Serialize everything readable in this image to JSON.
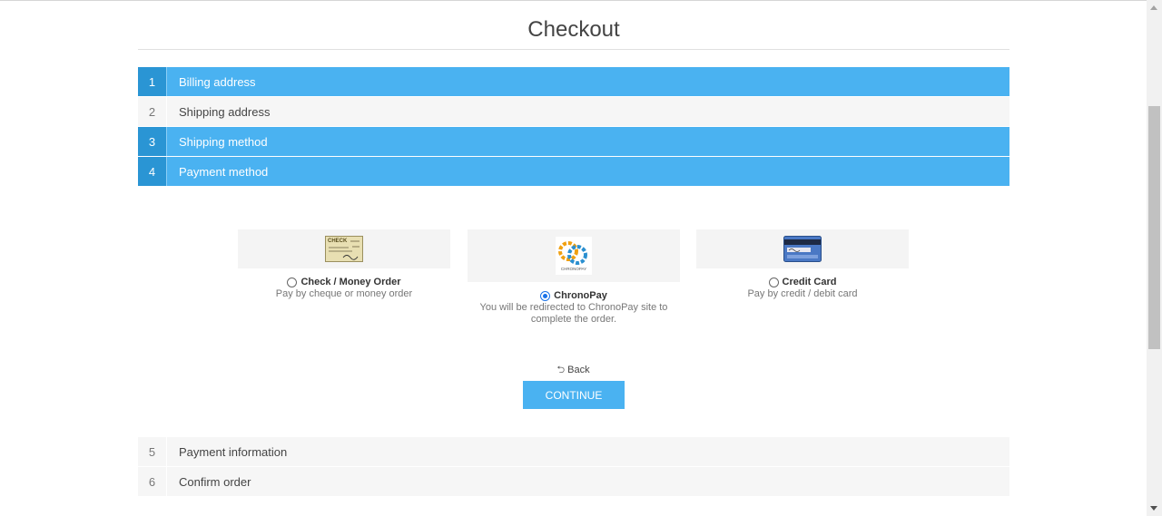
{
  "page": {
    "title": "Checkout"
  },
  "steps": [
    {
      "number": "1",
      "label": "Billing address",
      "state": "active"
    },
    {
      "number": "2",
      "label": "Shipping address",
      "state": "inactive"
    },
    {
      "number": "3",
      "label": "Shipping method",
      "state": "active"
    },
    {
      "number": "4",
      "label": "Payment method",
      "state": "active"
    },
    {
      "number": "5",
      "label": "Payment information",
      "state": "inactive"
    },
    {
      "number": "6",
      "label": "Confirm order",
      "state": "inactive"
    }
  ],
  "payment_methods": [
    {
      "name": "Check / Money Order",
      "description": "Pay by cheque or money order",
      "selected": false,
      "icon": "check-icon"
    },
    {
      "name": "ChronoPay",
      "description": "You will be redirected to ChronoPay site to complete the order.",
      "selected": true,
      "icon": "chronopay-logo"
    },
    {
      "name": "Credit Card",
      "description": "Pay by credit / debit card",
      "selected": false,
      "icon": "credit-card-icon"
    }
  ],
  "icons": {
    "check_text": "CHECK",
    "chronopay_text": "CHRONOPAY"
  },
  "actions": {
    "back_label": "Back",
    "continue_label": "CONTINUE"
  },
  "colors": {
    "accent": "#4ab2f1",
    "accent_dark": "#2a95d4",
    "inactive_bg": "#f6f6f6"
  }
}
